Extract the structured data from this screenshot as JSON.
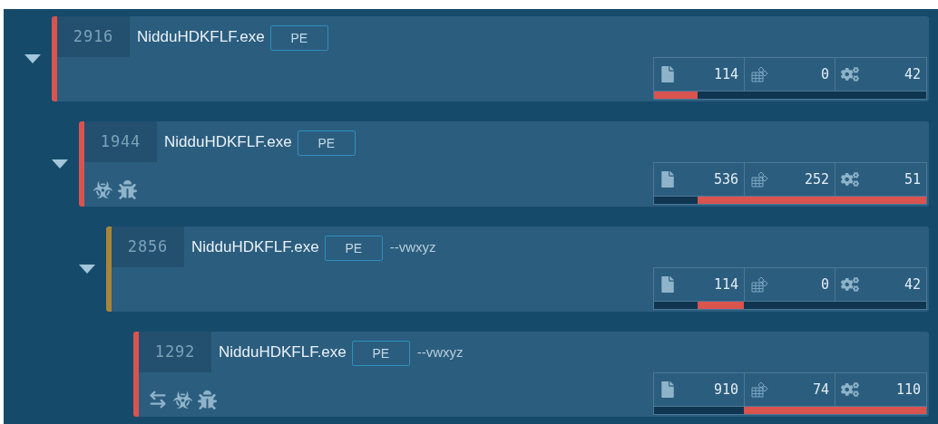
{
  "processes": [
    {
      "pid": "2916",
      "name": "NidduHDKFLF.exe",
      "type": "PE",
      "color": "#d9534f",
      "expanded": true,
      "network": false,
      "biohazard": false,
      "bug": false,
      "files": "114",
      "registry": "0",
      "threads": "42",
      "timeline": [
        {
          "kind": "active",
          "level": 0.16
        },
        {
          "kind": "idle",
          "level": 0.84
        }
      ],
      "children": [
        {
          "pid": "1944",
          "name": "NidduHDKFLF.exe",
          "type": "PE",
          "color": "#d9534f",
          "expanded": true,
          "network": false,
          "biohazard": true,
          "bug": true,
          "files": "536",
          "registry": "252",
          "threads": "51",
          "timeline": [
            {
              "kind": "idle",
              "level": 0.16
            },
            {
              "kind": "active",
              "level": 0.84
            }
          ],
          "children": [
            {
              "pid": "2856",
              "name": "NidduHDKFLF.exe",
              "type": "PE",
              "args": "--vwxyz",
              "color": "#a8853a",
              "expanded": true,
              "network": false,
              "biohazard": false,
              "bug": false,
              "files": "114",
              "registry": "0",
              "threads": "42",
              "timeline": [
                {
                  "kind": "idle",
                  "level": 0.16
                },
                {
                  "kind": "active",
                  "level": 0.17
                },
                {
                  "kind": "idle",
                  "level": 0.67
                }
              ],
              "children": [
                {
                  "pid": "1292",
                  "name": "NidduHDKFLF.exe",
                  "type": "PE",
                  "args": "--vwxyz",
                  "color": "#d9534f",
                  "network": true,
                  "biohazard": true,
                  "bug": true,
                  "files": "910",
                  "registry": "74",
                  "threads": "110",
                  "timeline": [
                    {
                      "kind": "idle",
                      "level": 0.33
                    },
                    {
                      "kind": "active",
                      "level": 0.67
                    }
                  ]
                }
              ]
            }
          ]
        }
      ]
    }
  ]
}
